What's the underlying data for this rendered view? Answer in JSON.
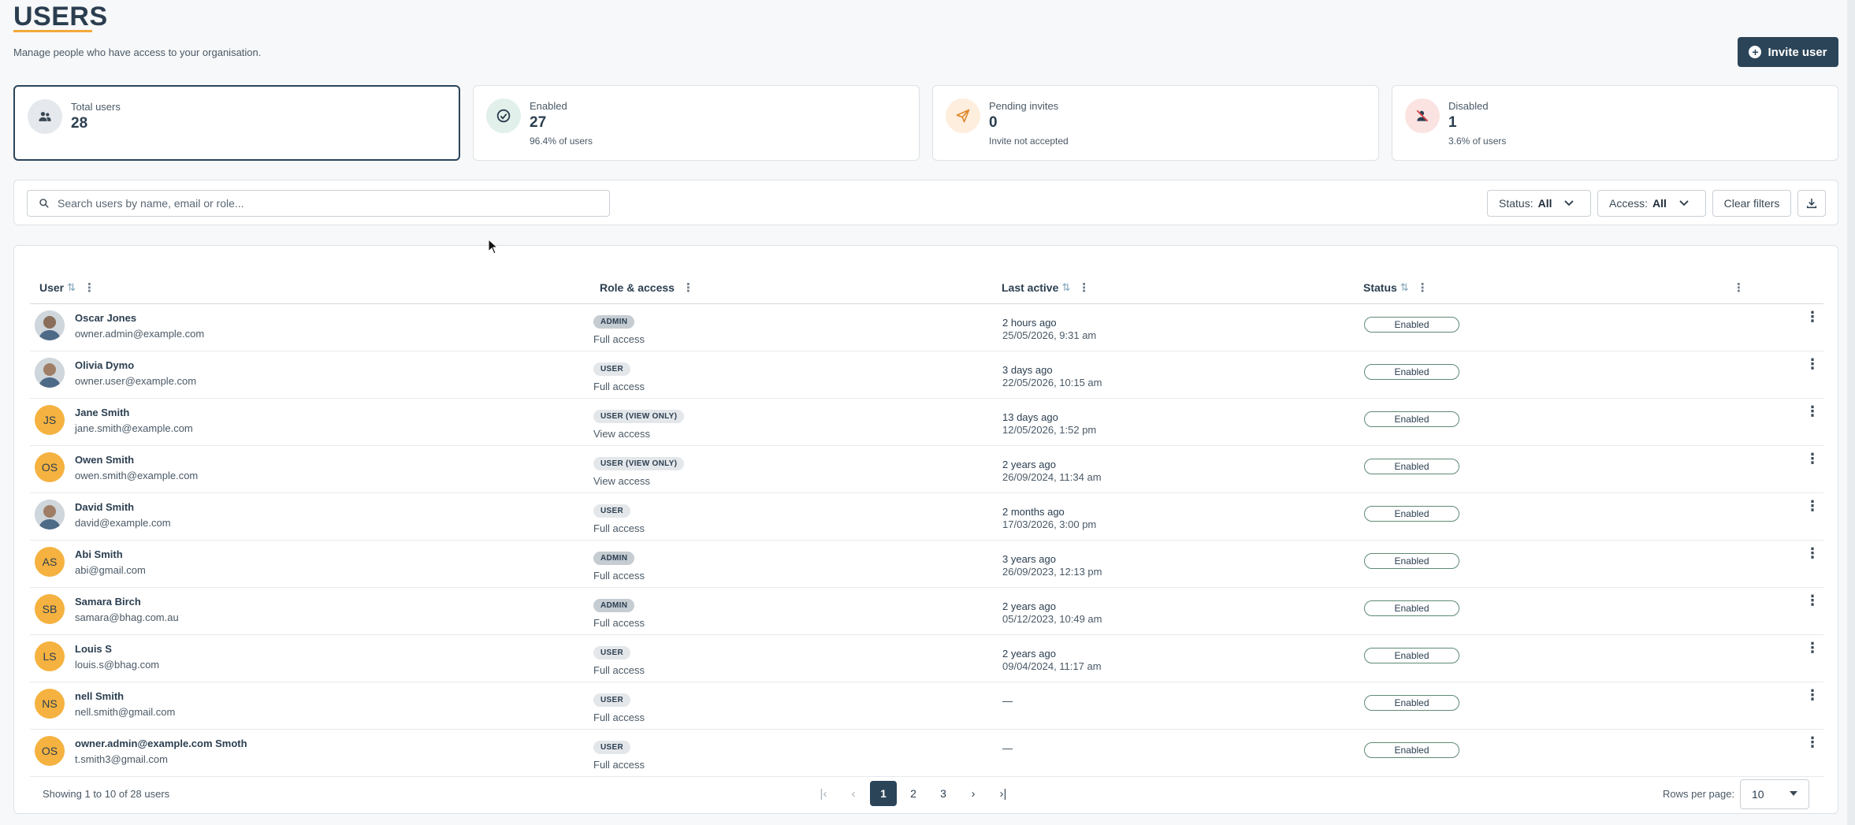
{
  "header": {
    "title": "USERS",
    "subtitle": "Manage people who have access to your organisation.",
    "invite_label": "Invite user"
  },
  "colors": {
    "primary": "#2b4458",
    "accent": "#f2a93b",
    "avatar_initials_bg": "#f5b240",
    "status_border": "#5e8a73"
  },
  "stats": [
    {
      "label": "Total users",
      "value": "28",
      "sub": "",
      "icon": "users-icon"
    },
    {
      "label": "Enabled",
      "value": "27",
      "sub": "96.4% of users",
      "icon": "check-circle-icon"
    },
    {
      "label": "Pending invites",
      "value": "0",
      "sub": "Invite not accepted",
      "icon": "send-icon"
    },
    {
      "label": "Disabled",
      "value": "1",
      "sub": "3.6% of users",
      "icon": "user-off-icon"
    }
  ],
  "filters": {
    "search_placeholder": "Search users by name, email or role...",
    "status_label": "Status:",
    "status_value": "All",
    "access_label": "Access:",
    "access_value": "All",
    "clear_label": "Clear filters"
  },
  "table": {
    "columns": {
      "user": "User",
      "role": "Role & access",
      "last_active": "Last active",
      "status": "Status"
    },
    "rows": [
      {
        "name": "Oscar Jones",
        "email": "owner.admin@example.com",
        "avatar": "photo",
        "initials": "",
        "role": "ADMIN",
        "access": "Full access",
        "last_rel": "2 hours ago",
        "last_abs": "25/05/2026, 9:31 am",
        "status": "Enabled"
      },
      {
        "name": "Olivia Dymo",
        "email": "owner.user@example.com",
        "avatar": "photo",
        "initials": "",
        "role": "USER",
        "access": "Full access",
        "last_rel": "3 days ago",
        "last_abs": "22/05/2026, 10:15 am",
        "status": "Enabled"
      },
      {
        "name": "Jane Smith",
        "email": "jane.smith@example.com",
        "avatar": "initials",
        "initials": "JS",
        "role": "USER (VIEW ONLY)",
        "access": "View access",
        "last_rel": "13 days ago",
        "last_abs": "12/05/2026, 1:52 pm",
        "status": "Enabled"
      },
      {
        "name": "Owen Smith",
        "email": "owen.smith@example.com",
        "avatar": "initials",
        "initials": "OS",
        "role": "USER (VIEW ONLY)",
        "access": "View access",
        "last_rel": "2 years ago",
        "last_abs": "26/09/2024, 11:34 am",
        "status": "Enabled"
      },
      {
        "name": "David Smith",
        "email": "david@example.com",
        "avatar": "photo",
        "initials": "",
        "role": "USER",
        "access": "Full access",
        "last_rel": "2 months ago",
        "last_abs": "17/03/2026, 3:00 pm",
        "status": "Enabled"
      },
      {
        "name": "Abi Smith",
        "email": "abi@gmail.com",
        "avatar": "initials",
        "initials": "AS",
        "role": "ADMIN",
        "access": "Full access",
        "last_rel": "3 years ago",
        "last_abs": "26/09/2023, 12:13 pm",
        "status": "Enabled"
      },
      {
        "name": "Samara Birch",
        "email": "samara@bhag.com.au",
        "avatar": "initials",
        "initials": "SB",
        "role": "ADMIN",
        "access": "Full access",
        "last_rel": "2 years ago",
        "last_abs": "05/12/2023, 10:49 am",
        "status": "Enabled"
      },
      {
        "name": "Louis S",
        "email": "louis.s@bhag.com",
        "avatar": "initials",
        "initials": "LS",
        "role": "USER",
        "access": "Full access",
        "last_rel": "2 years ago",
        "last_abs": "09/04/2024, 11:17 am",
        "status": "Enabled"
      },
      {
        "name": "nell Smith",
        "email": "nell.smith@gmail.com",
        "avatar": "initials",
        "initials": "NS",
        "role": "USER",
        "access": "Full access",
        "last_rel": "—",
        "last_abs": "",
        "status": "Enabled"
      },
      {
        "name": "owner.admin@example.com Smoth",
        "email": "t.smith3@gmail.com",
        "avatar": "initials",
        "initials": "OS",
        "role": "USER",
        "access": "Full access",
        "last_rel": "—",
        "last_abs": "",
        "status": "Enabled"
      }
    ]
  },
  "pagination": {
    "summary": "Showing 1 to 10 of 28 users",
    "pages": [
      "1",
      "2",
      "3"
    ],
    "current": "1",
    "rows_per_page_label": "Rows per page:",
    "rows_per_page": "10"
  }
}
